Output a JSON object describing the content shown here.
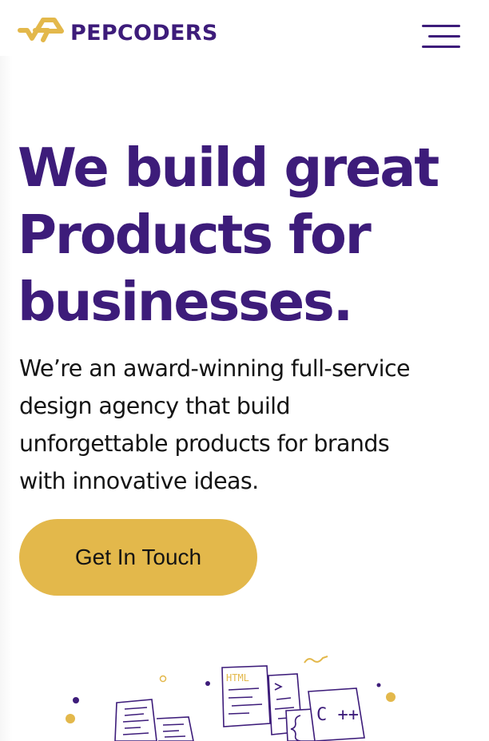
{
  "brand": {
    "name": "PEPCODERS",
    "colors": {
      "primary": "#3d1c7a",
      "accent": "#e3b84b",
      "text": "#141414"
    }
  },
  "header": {
    "menu_icon": "hamburger-menu-icon"
  },
  "hero": {
    "title_lines": [
      "We build great",
      "Products for",
      "businesses."
    ],
    "description_lines": [
      "We’re an award-winning full-service",
      "design agency that build",
      "unforgettable products for brands",
      "with innovative ideas."
    ],
    "cta_label": "Get In Touch"
  },
  "illustration": {
    "code_labels": [
      "HTML",
      "C ++"
    ]
  }
}
